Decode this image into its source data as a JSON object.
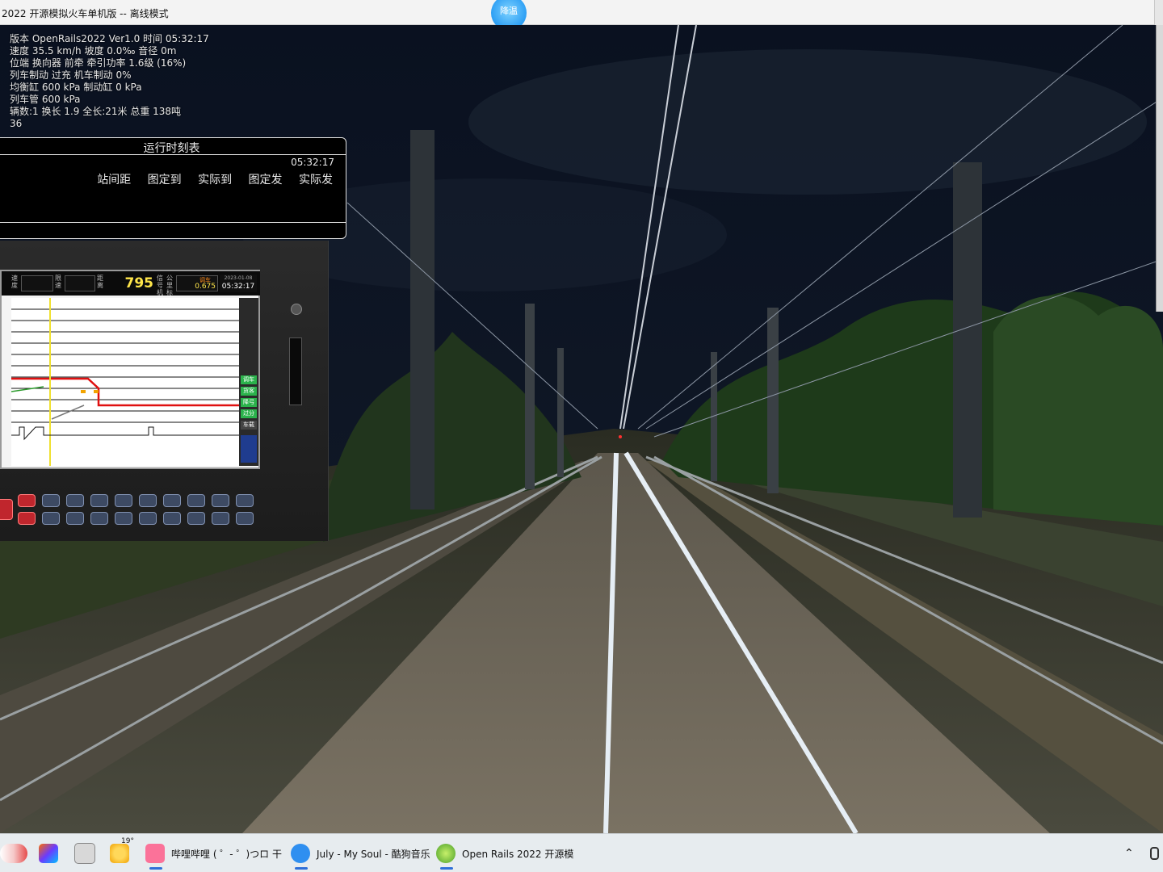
{
  "window": {
    "title": "2022 开源模拟火车单机版 -- 离线模式",
    "overlay_badge": "降温"
  },
  "hud": {
    "lines": [
      "版本 OpenRails2022 Ver1.0 时间 05:32:17",
      "速度 35.5 km/h 坡度 0.0‰ 音径 0m",
      "位端 换向器 前牵 牵引功率 1.6级 (16%)",
      "列车制动 过充 机车制动 0%",
      "均衡缸 600 kPa 制动缸 0 kPa",
      "列车管 600 kPa",
      "辆数:1 换长 1.9 全长:21米 总重 138吨",
      "36"
    ]
  },
  "timetable": {
    "title": "运行时刻表",
    "time": "05:32:17",
    "columns": [
      "站间距",
      "图定到",
      "实际到",
      "图定发",
      "实际发"
    ]
  },
  "lkj": {
    "speed_label": "速度",
    "limit_label": "限速",
    "dist_label": "距离",
    "distance": "795",
    "signal_label": "信号机",
    "km_label": "公里标",
    "km": "0.675",
    "km_top": "调车",
    "date": "2023-01-08",
    "clock": "05:32:17",
    "side_labels": [
      "调车",
      "货客",
      "降弓",
      "过分",
      "车载"
    ]
  },
  "taskbar": {
    "weather_temp": "19°",
    "items": [
      {
        "label": "哔哩哔哩 ( ゜- ゜)つロ 干",
        "icon": "bilibili-icon"
      },
      {
        "label": "July - My Soul - 酷狗音乐",
        "icon": "kugou-icon"
      },
      {
        "label": "Open Rails 2022 开源模",
        "icon": "openrails-icon"
      }
    ]
  },
  "colors": {
    "sky": "#0b1220",
    "trees": "#1e3a1a",
    "rail": "#e6eef5",
    "taskbar": "#e7ecef",
    "lkj_yellow": "#ffe64a",
    "lkj_red": "#e01010"
  }
}
